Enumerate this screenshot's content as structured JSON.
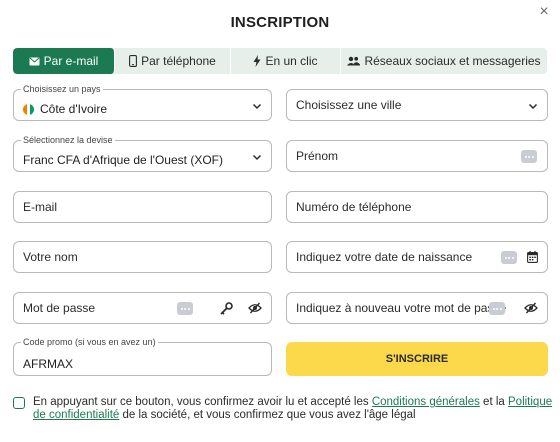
{
  "title": "INSCRIPTION",
  "close_symbol": "×",
  "tabs": [
    {
      "label": "Par e-mail",
      "icon": "envelope-icon",
      "active": true
    },
    {
      "label": "Par téléphone",
      "icon": "phone-icon",
      "active": false
    },
    {
      "label": "En un clic",
      "icon": "lightning-icon",
      "active": false
    },
    {
      "label": "Réseaux sociaux et messageries",
      "icon": "users-icon",
      "active": false
    }
  ],
  "fields": {
    "country": {
      "legend": "Choisissez un pays",
      "value": "Côte d'Ivoire"
    },
    "city": {
      "placeholder": "Choisissez une ville"
    },
    "currency": {
      "legend": "Sélectionnez la devise",
      "value": "Franc CFA d'Afrique de l'Ouest (XOF)"
    },
    "first_name": {
      "placeholder": "Prénom"
    },
    "email": {
      "placeholder": "E-mail"
    },
    "phone": {
      "placeholder": "Numéro de téléphone"
    },
    "last_name": {
      "placeholder": "Votre nom"
    },
    "birthdate": {
      "placeholder": "Indiquez votre date de naissance"
    },
    "password": {
      "placeholder": "Mot de passe"
    },
    "password_repeat": {
      "placeholder": "Indiquez à nouveau votre mot de passe"
    },
    "promo": {
      "legend": "Code promo (si vous en avez un)",
      "value": "AFRMAX"
    }
  },
  "submit_label": "S'INSCRIRE",
  "terms": {
    "part1": "En appuyant sur ce bouton, vous confirmez avoir lu et accepté les ",
    "link1": "Conditions générales",
    "part2": " et la ",
    "link2": "Politique de confidentialité",
    "part3": " de la société, et vous confirmez que vous avez l'âge légal"
  },
  "colors": {
    "accent": "#1c7a52",
    "submit": "#fbd94b",
    "tab_bg": "#e6efe9"
  },
  "flag_colors": [
    "#f77f00",
    "#ffffff",
    "#009e60"
  ]
}
